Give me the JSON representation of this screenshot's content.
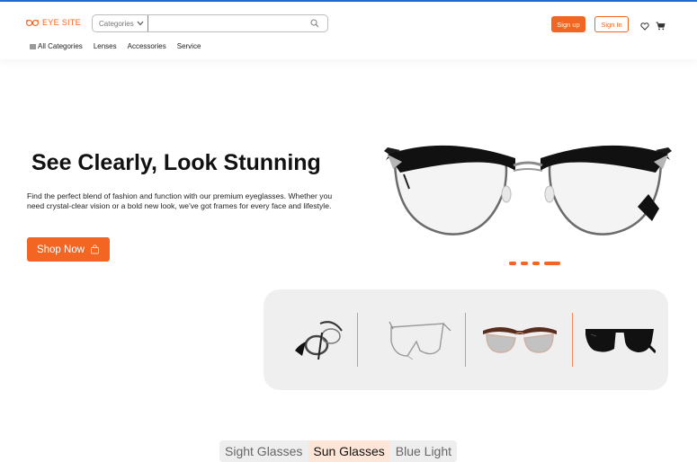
{
  "header": {
    "logo_text": "EYE SITE",
    "search": {
      "category_label": "Categories",
      "placeholder": ""
    },
    "signup_label": "Sign up",
    "signin_label": "Sign In"
  },
  "nav": {
    "items": [
      {
        "label": "All Categories",
        "icon": "menu-icon"
      },
      {
        "label": "Lenses"
      },
      {
        "label": "Accessories"
      },
      {
        "label": "Service"
      }
    ]
  },
  "hero": {
    "title": "See Clearly, Look Stunning",
    "description": "Find the perfect blend of fashion and function with our premium eyeglasses. Whether you need crystal-clear vision or a bold new look, we've got frames for every face and lifestyle.",
    "cta_label": "Shop Now",
    "slides_total": 4,
    "active_slide": 4
  },
  "thumbnails": [
    {
      "icon": "eyeglasses-side-view-icon"
    },
    {
      "icon": "rimless-glasses-icon"
    },
    {
      "icon": "browline-sunglasses-icon"
    },
    {
      "icon": "black-sunglasses-icon"
    }
  ],
  "tabs": [
    {
      "label": "Sight Glasses",
      "active": false
    },
    {
      "label": "Sun Glasses",
      "active": true
    },
    {
      "label": "Blue Light",
      "active": false
    }
  ],
  "colors": {
    "accent": "#f26522",
    "panel_bg": "#efefef",
    "active_tab_bg": "#fde5d8"
  }
}
